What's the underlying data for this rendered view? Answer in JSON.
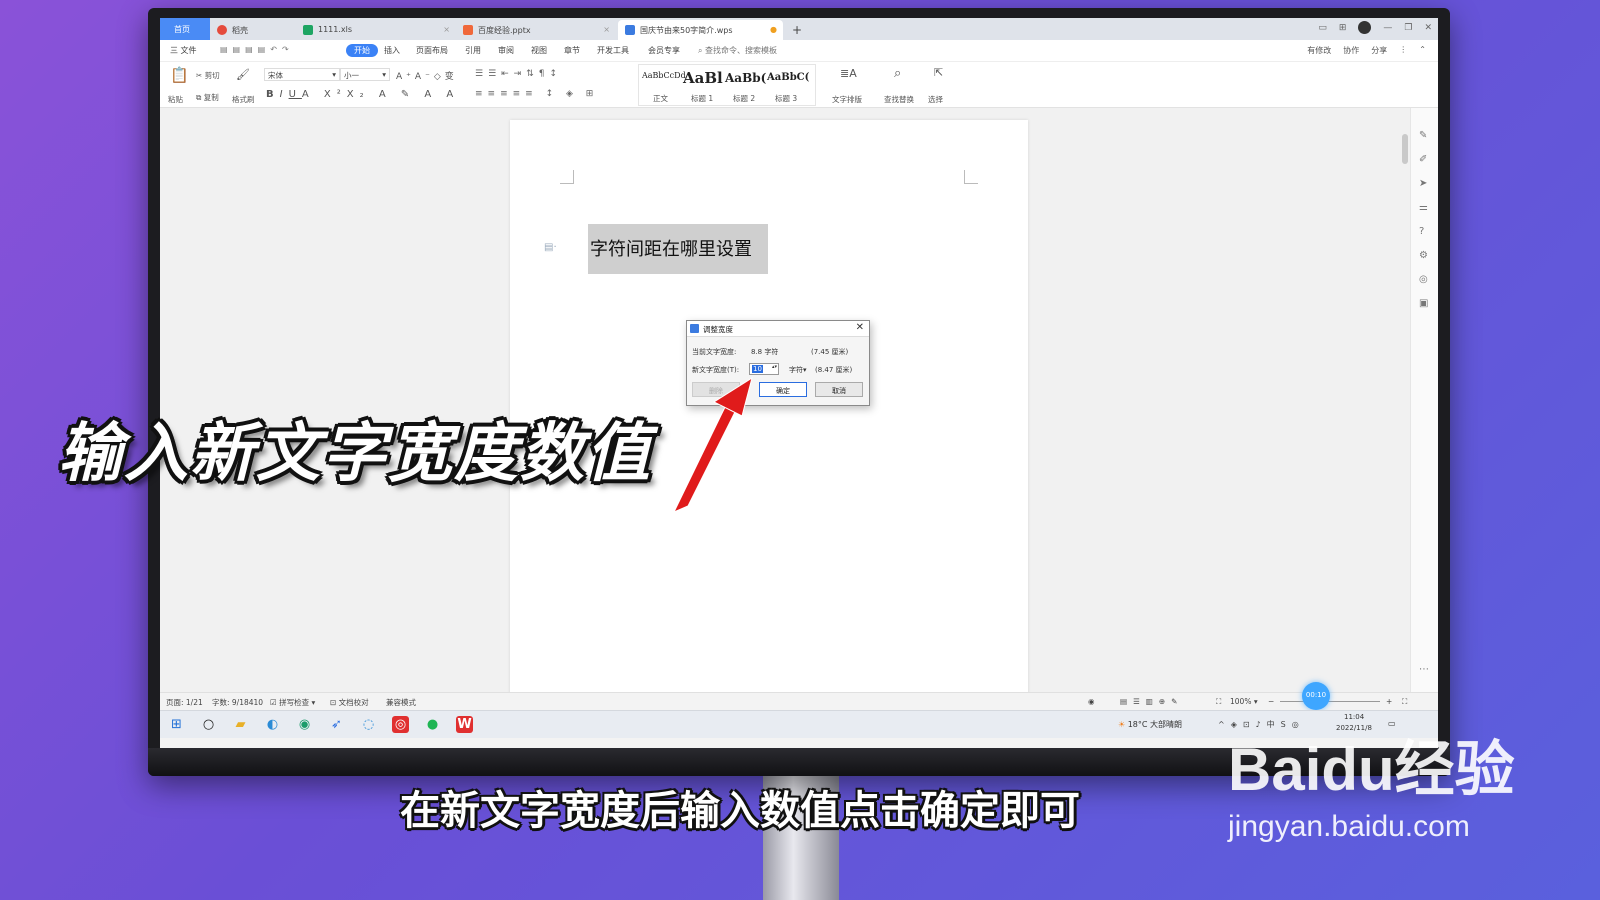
{
  "tabs": [
    {
      "label": "首页"
    },
    {
      "label": "稻壳",
      "color": "#e54b3c"
    },
    {
      "label": "1111.xls",
      "color": "#1ea563"
    },
    {
      "label": "百度经验.pptx",
      "color": "#f0683a"
    },
    {
      "label": "国庆节由来50字简介.wps",
      "color": "#3b7be0"
    }
  ],
  "menu": {
    "file": "三 文件",
    "items": [
      "开始",
      "插入",
      "页面布局",
      "引用",
      "审阅",
      "视图",
      "章节",
      "开发工具",
      "会员专享"
    ],
    "search": "查找命令、搜索模板",
    "right": [
      "有修改",
      "协作",
      "分享"
    ]
  },
  "ribbon": {
    "paste": "粘贴",
    "cut": "剪切",
    "copy": "复制",
    "format_painter": "格式刷",
    "font_name": "宋体",
    "font_size": "小一",
    "styles": [
      {
        "sample": "AaBbCcDd",
        "label": "正文"
      },
      {
        "sample": "AaBl",
        "label": "标题 1"
      },
      {
        "sample": "AaBb(",
        "label": "标题 2"
      },
      {
        "sample": "AaBbC(",
        "label": "标题 3"
      }
    ],
    "text_layout": "文字排版",
    "find_replace": "查找替换",
    "select": "选择"
  },
  "document": {
    "heading": "字符间距在哪里设置"
  },
  "dialog": {
    "title": "调整宽度",
    "current_label": "当前文字宽度:",
    "current_value": "8.8 字符",
    "current_cm": "(7.45 厘米)",
    "new_label": "新文字宽度(T):",
    "new_value": "10",
    "unit": "字符",
    "new_cm": "(8.47 厘米)",
    "delete_btn": "删除",
    "ok_btn": "确定",
    "cancel_btn": "取消"
  },
  "status": {
    "page": "页面: 1/21",
    "words": "字数: 9/18410",
    "spell": "拼写检查",
    "proof": "文档校对",
    "compat": "兼容模式",
    "zoom": "100%",
    "timer": "00:10"
  },
  "taskbar": {
    "weather": "18°C 大部晴朗",
    "time": "11:04",
    "date": "2022/11/8"
  },
  "overlay": {
    "big_text": "输入新文字宽度数值",
    "caption": "在新文字宽度后输入数值点击确定即可"
  },
  "watermark": {
    "logo": "Baidu经验",
    "url": "jingyan.baidu.com"
  },
  "colors": {
    "accent": "#3b82f6",
    "arrow": "#e01b1b"
  }
}
